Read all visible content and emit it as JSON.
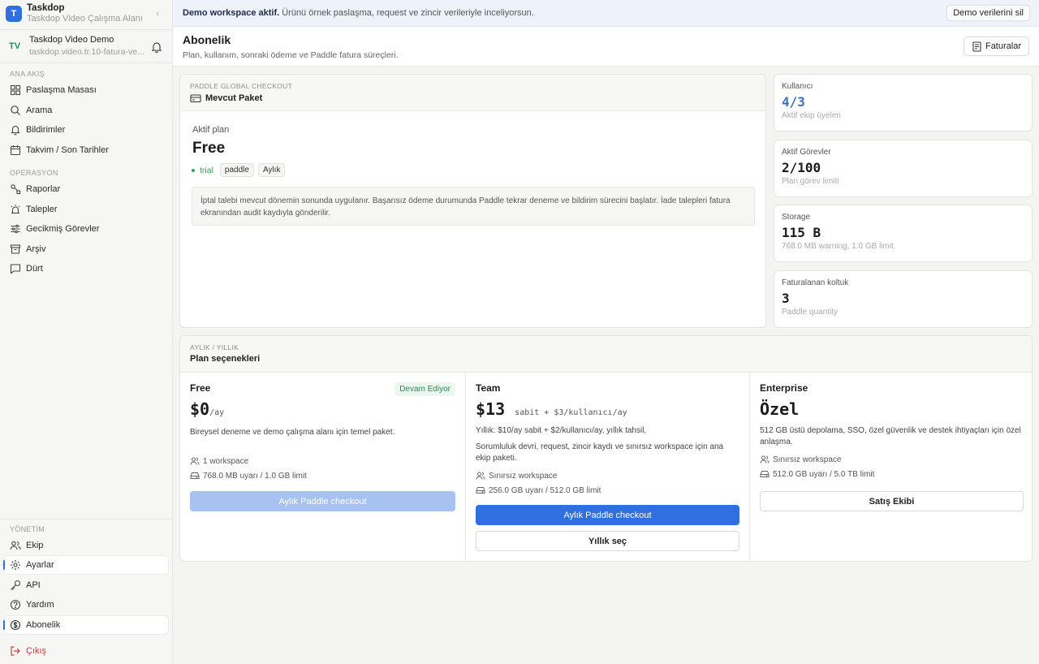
{
  "app": {
    "logo_letter": "T",
    "name": "Taskdop",
    "subtitle": "Taskdop Video Çalışma Alanı",
    "collapse": "‹"
  },
  "workspace": {
    "avatar": "TV",
    "name": "Taskdop Video Demo",
    "url": "taskdop.video.tr.10-fatura-ve..."
  },
  "sidebar": {
    "main_section": "ANA AKIŞ",
    "main_items": [
      "Paslaşma Masası",
      "Arama",
      "Bildirimler",
      "Takvim / Son Tarihler"
    ],
    "ops_section": "OPERASYON",
    "ops_items": [
      "Raporlar",
      "Talepler",
      "Gecikmiş Görevler",
      "Arşiv",
      "Dürt"
    ],
    "admin_section": "YÖNETİM",
    "admin_items": [
      "Ekip",
      "Ayarlar",
      "API",
      "Yardım",
      "Abonelik"
    ],
    "logout": "Çıkış"
  },
  "banner": {
    "bold": "Demo workspace aktif.",
    "text": "Ürünü örnek paslaşma, request ve zincir verileriyle inceliyorsun.",
    "button": "Demo verilerini sil"
  },
  "header": {
    "title": "Abonelik",
    "subtitle": "Plan, kullanım, sonraki ödeme ve Paddle fatura süreçleri.",
    "invoices_button": "Faturalar"
  },
  "current": {
    "kicker": "PADDLE GLOBAL CHECKOUT",
    "title": "Mevcut Paket",
    "active_label": "Aktif plan",
    "plan": "Free",
    "status": "trial",
    "tags": [
      "paddle",
      "Aylık"
    ],
    "note": "İptal talebi mevcut dönemin sonunda uygulanır. Başarısız ödeme durumunda Paddle tekrar deneme ve bildirim sürecini başlatır. İade talepleri fatura ekranından audit kaydıyla gönderilir."
  },
  "stats": [
    {
      "label": "Kullanıcı",
      "value": "4/3",
      "sub": "Aktif ekip üyeleri"
    },
    {
      "label": "Aktif Görevler",
      "value": "2/100",
      "sub": "Plan görev limiti"
    },
    {
      "label": "Storage",
      "value": "115 B",
      "sub": "768.0 MB warning, 1.0 GB limit"
    },
    {
      "label": "Faturalanan koltuk",
      "value": "3",
      "sub": "Paddle quantity"
    }
  ],
  "plans": {
    "kicker": "AYLIK / YILLIK",
    "title": "Plan seçenekleri",
    "free": {
      "name": "Free",
      "badge": "Devam Ediyor",
      "price": "$0",
      "unit": "/ay",
      "desc": "Bireysel deneme ve demo çalışma alanı için temel paket.",
      "f1": "1 workspace",
      "f2": "768.0 MB uyarı / 1.0 GB limit",
      "button": "Aylık Paddle checkout"
    },
    "team": {
      "name": "Team",
      "price": "$13",
      "unit": "sabit + $3/kullanıcı/ay",
      "yearly": "Yıllık: $10/ay sabit + $2/kullanıcı/ay, yıllık tahsil.",
      "desc": "Sorumluluk devri, request, zincir kaydı ve sınırsız workspace için ana ekip paketi.",
      "f1": "Sınırsız workspace",
      "f2": "256.0 GB uyarı / 512.0 GB limit",
      "button": "Aylık Paddle checkout",
      "button2": "Yıllık seç"
    },
    "enterprise": {
      "name": "Enterprise",
      "price": "Özel",
      "desc": "512 GB üstü depolama, SSO, özel güvenlik ve destek ihtiyaçları için özel anlaşma.",
      "f1": "Sınırsız workspace",
      "f2": "512.0 GB uyarı / 5.0 TB limit",
      "button": "Satış Ekibi"
    }
  },
  "colors": {
    "accent": "#2f6fe0",
    "success": "#2aa266",
    "danger": "#d23b3b"
  }
}
